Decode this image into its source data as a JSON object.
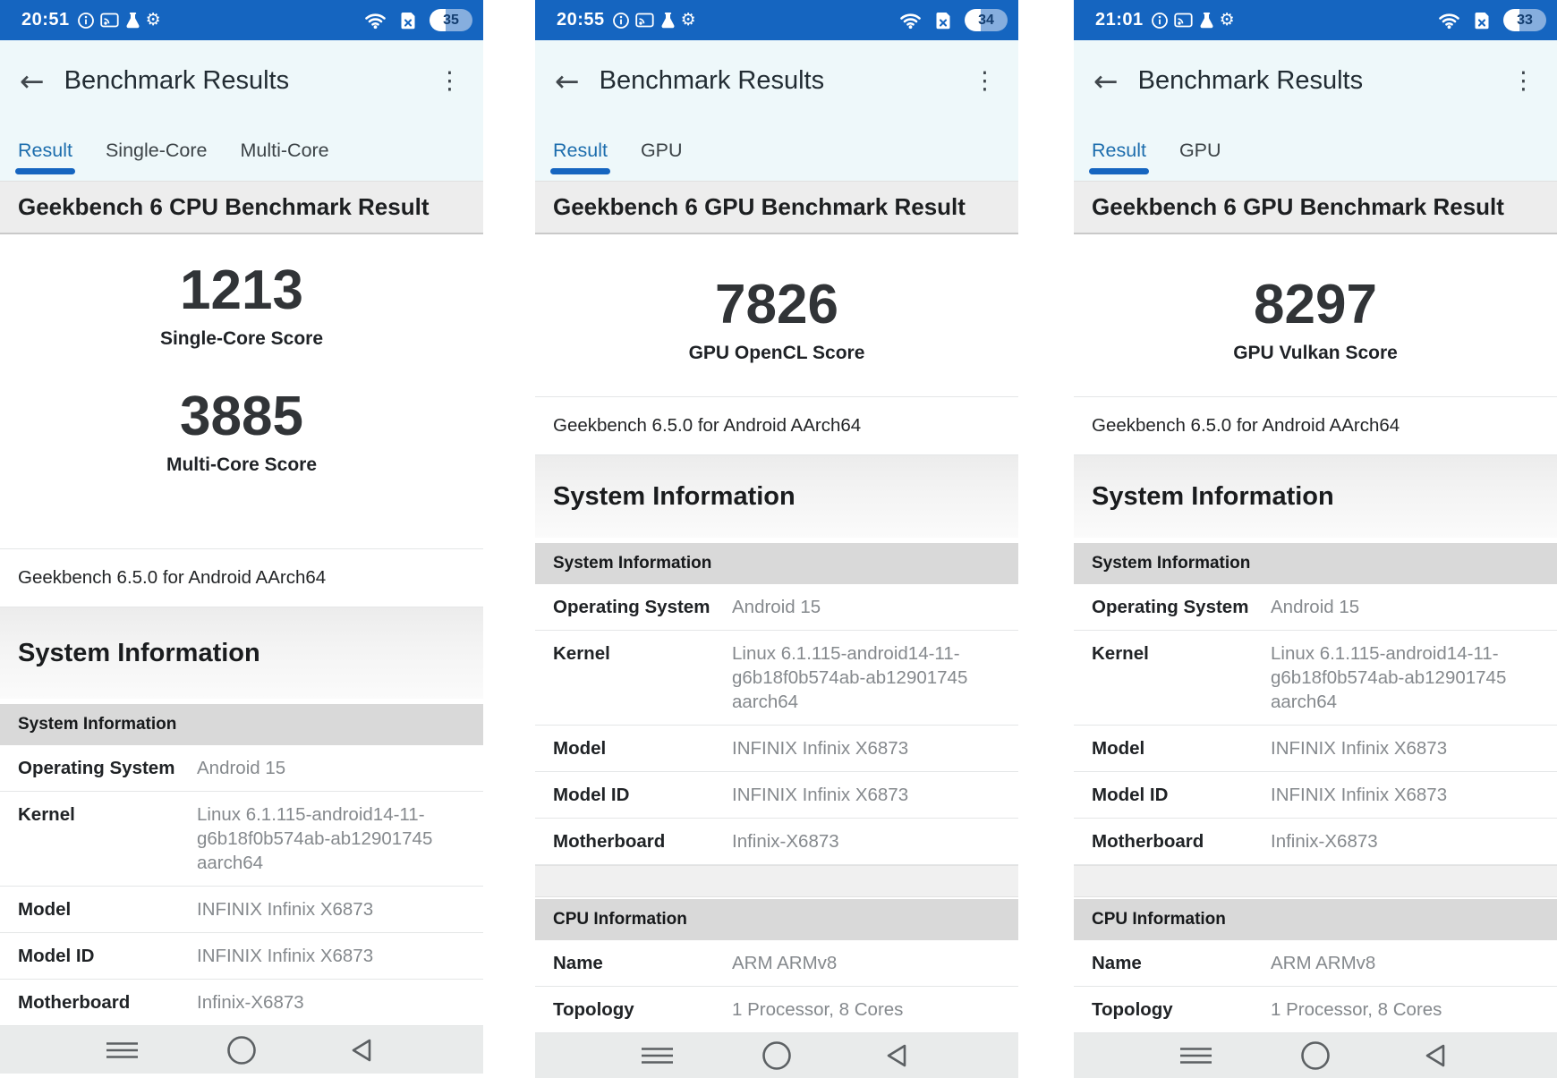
{
  "header": {
    "title": "Benchmark Results",
    "back_icon": "arrow-left",
    "menu_icon": "kebab-menu"
  },
  "colors": {
    "statusbar_blue": "#1565c0",
    "header_bg": "#eef8fa",
    "active_tab_blue": "#1c6dad",
    "tab_underline": "#1565c0",
    "band_gray": "#ededed",
    "subband_gray": "#d9d9d9",
    "value_gray": "#85898d",
    "navbar_gray": "#e9ebeb"
  },
  "panels": [
    {
      "status": {
        "time": "20:51",
        "battery": "35"
      },
      "tabs": [
        {
          "label": "Result"
        },
        {
          "label": "Single-Core"
        },
        {
          "label": "Multi-Core"
        }
      ],
      "result_title": "Geekbench 6 CPU Benchmark Result",
      "scores": [
        {
          "value": "1213",
          "label": "Single-Core Score"
        },
        {
          "value": "3885",
          "label": "Multi-Core Score"
        }
      ],
      "version": "Geekbench 6.5.0 for Android AArch64",
      "section_title": "System Information",
      "sysinfo": {
        "header": "System Information",
        "rows": [
          {
            "label": "Operating System",
            "value": "Android 15"
          },
          {
            "label": "Kernel",
            "value": "Linux 6.1.115-android14-11-\ng6b18f0b574ab-ab12901745\naarch64"
          },
          {
            "label": "Model",
            "value": "INFINIX Infinix X6873"
          },
          {
            "label": "Model ID",
            "value": "INFINIX Infinix X6873"
          },
          {
            "label": "Motherboard",
            "value": "Infinix-X6873"
          }
        ]
      }
    },
    {
      "status": {
        "time": "20:55",
        "battery": "34"
      },
      "tabs": [
        {
          "label": "Result"
        },
        {
          "label": "GPU"
        }
      ],
      "result_title": "Geekbench 6 GPU Benchmark Result",
      "scores": [
        {
          "value": "7826",
          "label": "GPU OpenCL Score"
        }
      ],
      "version": "Geekbench 6.5.0 for Android AArch64",
      "section_title": "System Information",
      "sysinfo": {
        "header": "System Information",
        "rows": [
          {
            "label": "Operating System",
            "value": "Android 15"
          },
          {
            "label": "Kernel",
            "value": "Linux 6.1.115-android14-11-\ng6b18f0b574ab-ab12901745\naarch64"
          },
          {
            "label": "Model",
            "value": "INFINIX Infinix X6873"
          },
          {
            "label": "Model ID",
            "value": "INFINIX Infinix X6873"
          },
          {
            "label": "Motherboard",
            "value": "Infinix-X6873"
          }
        ]
      },
      "cpuinfo": {
        "header": "CPU Information",
        "rows": [
          {
            "label": "Name",
            "value": "ARM ARMv8"
          },
          {
            "label": "Topology",
            "value": "1 Processor, 8 Cores"
          }
        ]
      }
    },
    {
      "status": {
        "time": "21:01",
        "battery": "33"
      },
      "tabs": [
        {
          "label": "Result"
        },
        {
          "label": "GPU"
        }
      ],
      "result_title": "Geekbench 6 GPU Benchmark Result",
      "scores": [
        {
          "value": "8297",
          "label": "GPU Vulkan Score"
        }
      ],
      "version": "Geekbench 6.5.0 for Android AArch64",
      "section_title": "System Information",
      "sysinfo": {
        "header": "System Information",
        "rows": [
          {
            "label": "Operating System",
            "value": "Android 15"
          },
          {
            "label": "Kernel",
            "value": "Linux 6.1.115-android14-11-\ng6b18f0b574ab-ab12901745\naarch64"
          },
          {
            "label": "Model",
            "value": "INFINIX Infinix X6873"
          },
          {
            "label": "Model ID",
            "value": "INFINIX Infinix X6873"
          },
          {
            "label": "Motherboard",
            "value": "Infinix-X6873"
          }
        ]
      },
      "cpuinfo": {
        "header": "CPU Information",
        "rows": [
          {
            "label": "Name",
            "value": "ARM ARMv8"
          },
          {
            "label": "Topology",
            "value": "1 Processor, 8 Cores"
          }
        ]
      }
    }
  ]
}
